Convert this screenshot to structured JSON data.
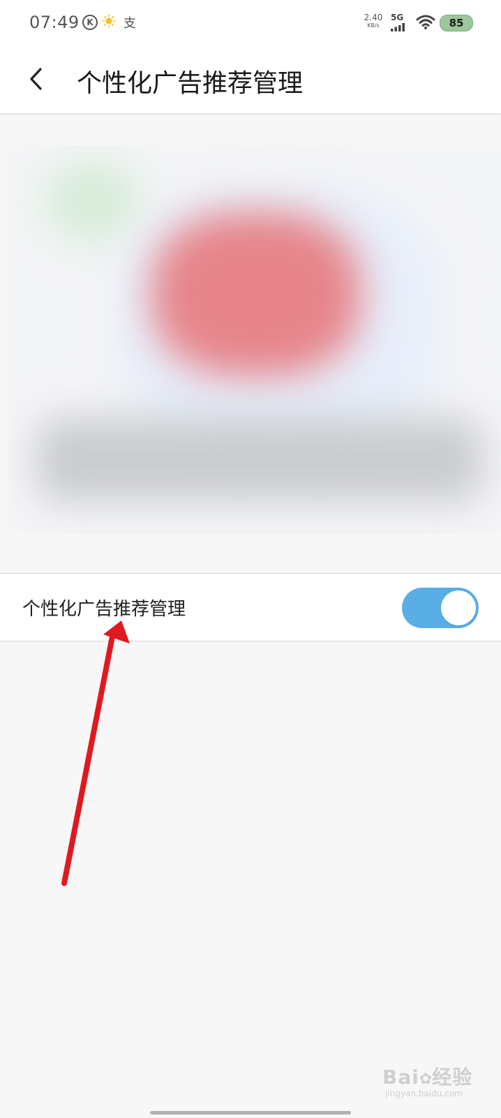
{
  "status_bar": {
    "time": "07:49",
    "k_label": "K",
    "app_glyph": "支",
    "speed_value": "2.40",
    "speed_unit": "KB/s",
    "network_type": "5G",
    "battery": "85",
    "icons": [
      "k-circle-icon",
      "sun-icon",
      "app-notification-icon",
      "signal-icon",
      "wifi-icon",
      "battery-icon"
    ]
  },
  "header": {
    "title": "个性化广告推荐管理",
    "back_icon": "chevron-left-icon"
  },
  "setting": {
    "label": "个性化广告推荐管理",
    "toggle_on": true,
    "toggle_color": "#5aaee6"
  },
  "watermark": {
    "logo_left": "Bai",
    "logo_right": "经验",
    "url": "jingyan.baidu.com"
  },
  "colors": {
    "annotation_arrow": "#e0191f",
    "toggle_track": "#5aaee6",
    "background": "#f7f7f7"
  }
}
